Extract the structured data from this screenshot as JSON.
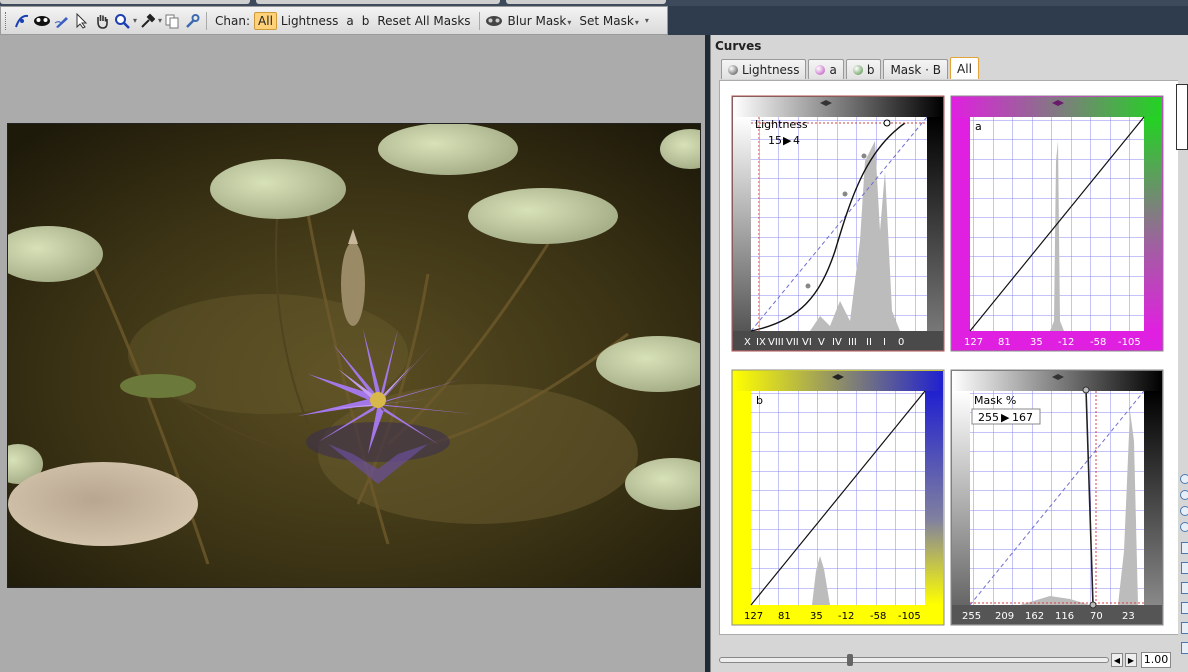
{
  "toolbar": {
    "chan_label": "Chan:",
    "channels": [
      "All",
      "Lightness",
      "a",
      "b"
    ],
    "selected_channel": "All",
    "reset_label": "Reset All Masks",
    "blur_mask_label": "Blur Mask",
    "set_mask_label": "Set Mask",
    "icons": [
      "curve-tool-icon",
      "mask-icon",
      "pen-icon",
      "pointer-icon",
      "hand-icon",
      "zoom-icon",
      "eyedropper-icon",
      "copy-icon",
      "wrench-icon",
      "blur-mask-icon"
    ]
  },
  "panel": {
    "title": "Curves",
    "tabs": [
      {
        "label": "Lightness",
        "dot": "#6a6a6a"
      },
      {
        "label": "a",
        "dot": "#b845b8"
      },
      {
        "label": "b",
        "dot": "#5a8a3a"
      },
      {
        "label": "Mask · B",
        "dot": ""
      },
      {
        "label": "All",
        "dot": ""
      }
    ],
    "active_tab": "All",
    "curves": {
      "lightness": {
        "label": "Lightness",
        "readout_in": "15",
        "readout_out": "4",
        "axis": [
          "X",
          "IX",
          "VIII",
          "VII",
          "VI",
          "V",
          "IV",
          "III",
          "II",
          "I",
          "0"
        ]
      },
      "a": {
        "label": "a",
        "axis": [
          "127",
          "81",
          "35",
          "-12",
          "-58",
          "-105"
        ]
      },
      "b": {
        "label": "b",
        "axis": [
          "127",
          "81",
          "35",
          "-12",
          "-58",
          "-105"
        ]
      },
      "mask": {
        "label": "Mask %",
        "readout_in": "255",
        "readout_out": "167",
        "axis": [
          "255",
          "209",
          "162",
          "116",
          "70",
          "23"
        ]
      }
    },
    "zoom": "1.00"
  },
  "colors": {
    "accent": "#e4a23a",
    "magenta": "#e020e0",
    "green": "#22d322",
    "yellow": "#ffff00",
    "blue": "#2020d0"
  }
}
